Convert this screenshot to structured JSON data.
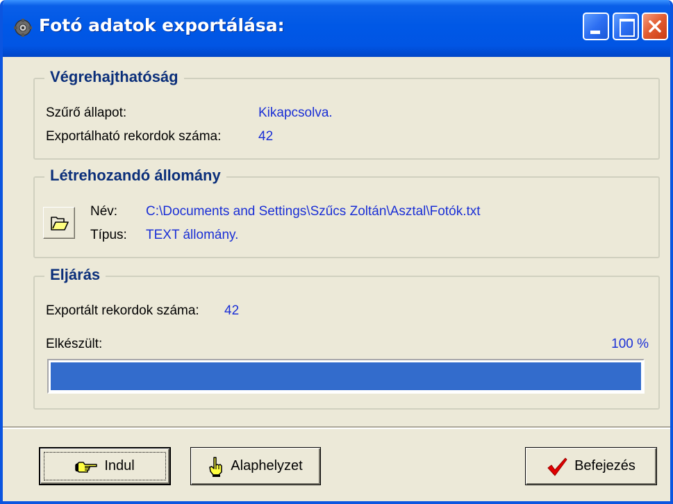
{
  "window": {
    "title": "Fotó adatok exportálása:"
  },
  "executability": {
    "title": "Végrehajthatóság",
    "filter_label": "Szűrő állapot:",
    "filter_value": "Kikapcsolva.",
    "records_label": "Exportálható rekordok száma:",
    "records_value": "42"
  },
  "target_file": {
    "title": "Létrehozandó állomány",
    "name_label": "Név:",
    "name_value": "C:\\Documents and Settings\\Szűcs Zoltán\\Asztal\\Fotók.txt",
    "type_label": "Típus:",
    "type_value": "TEXT állomány."
  },
  "procedure": {
    "title": "Eljárás",
    "exported_label": "Exportált rekordok száma:",
    "exported_value": "42",
    "done_label": "Elkészült:",
    "progress_text": "100 %",
    "progress_fraction": 1.0
  },
  "buttons": {
    "start": "Indul",
    "reset": "Alaphelyzet",
    "finish": "Befejezés"
  },
  "colors": {
    "title_bar": "#0058e6",
    "value_text": "#1a2fd6",
    "progress_fill": "#336ccc",
    "group_title": "#0b2f7a"
  }
}
